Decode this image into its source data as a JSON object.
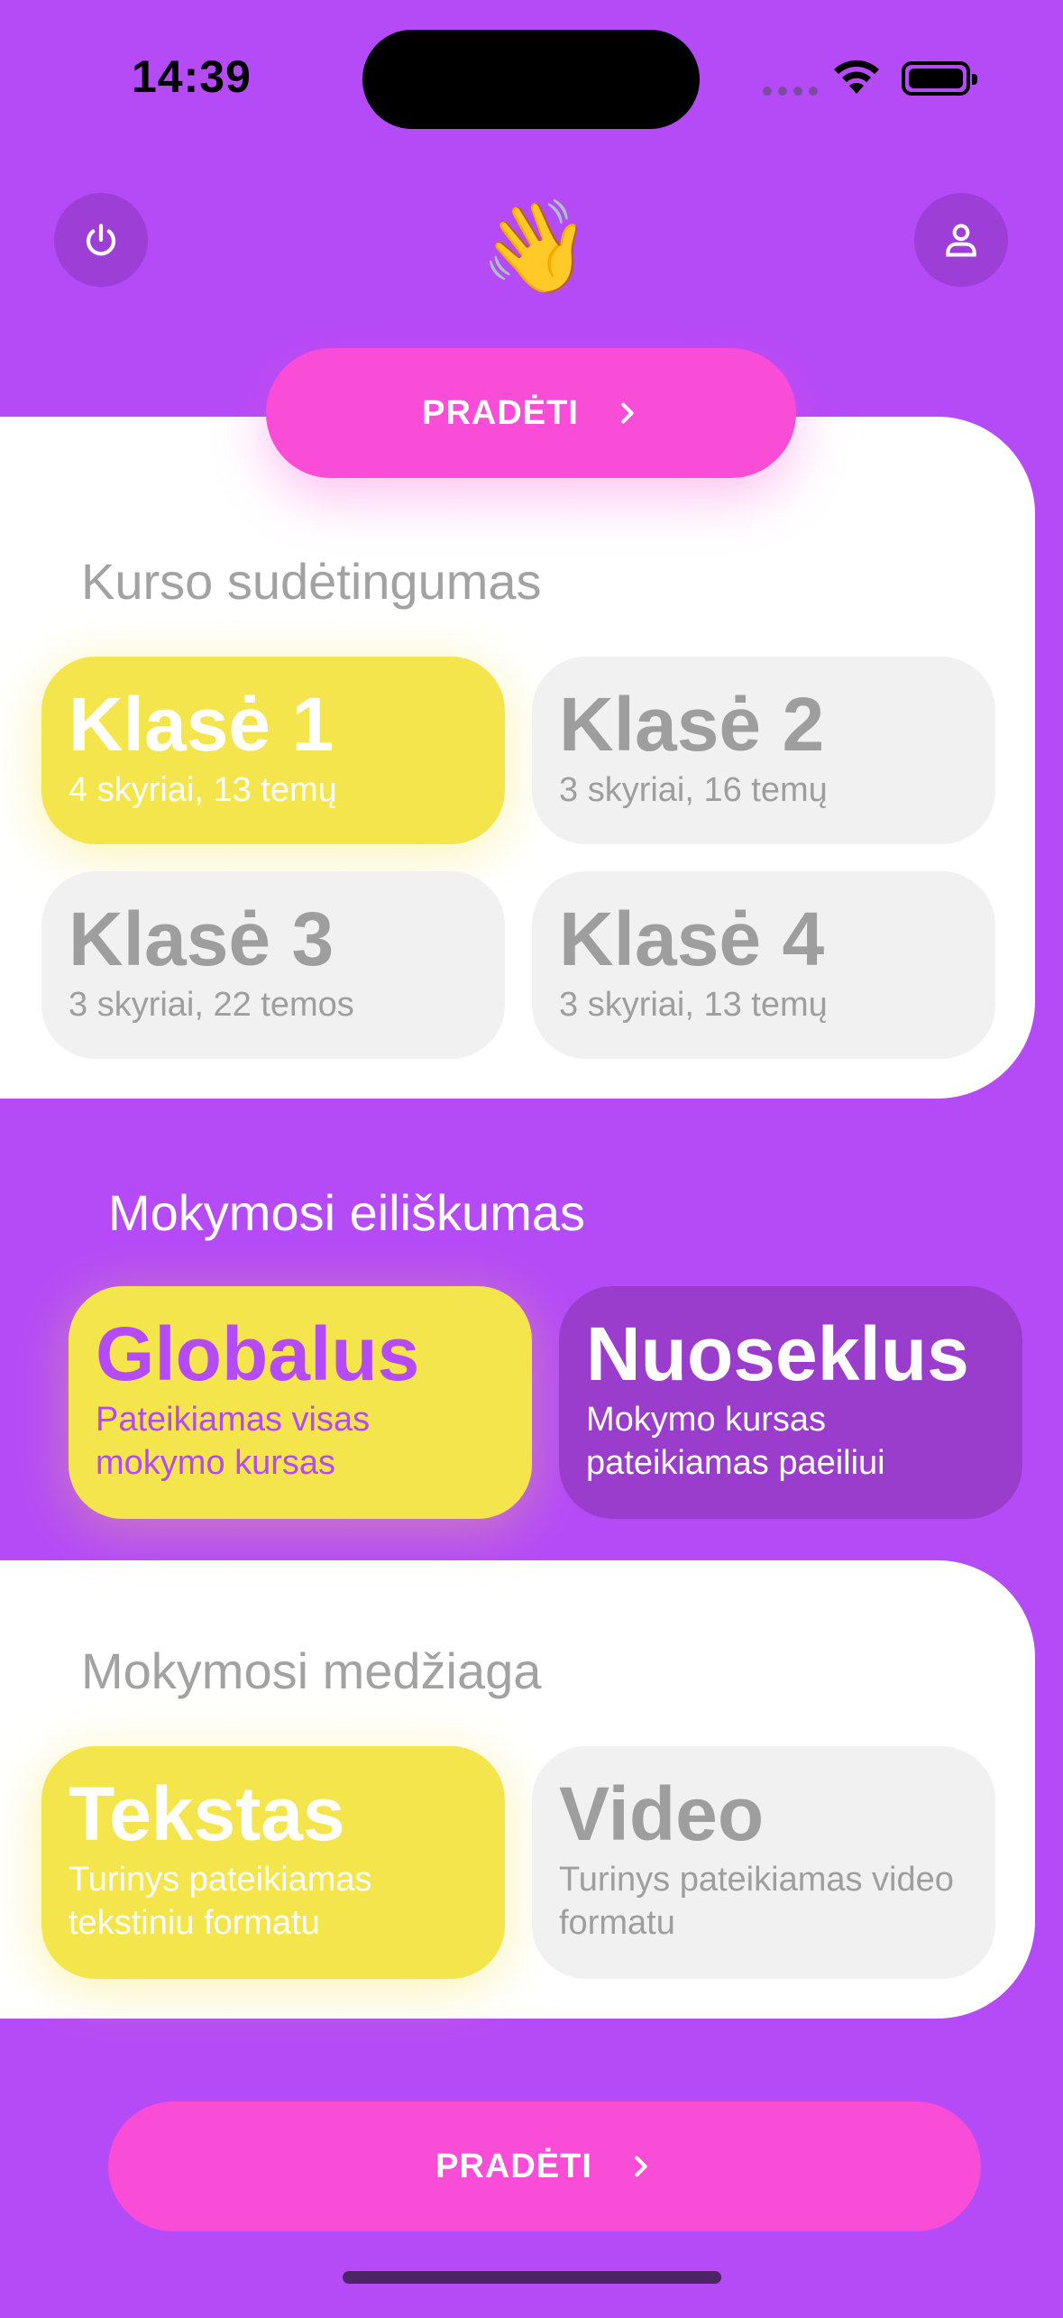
{
  "status_bar": {
    "time": "14:39"
  },
  "header": {
    "emoji": "👋",
    "power_icon": "power-icon",
    "profile_icon": "user-icon"
  },
  "start_button_top": {
    "label": "PRADĖTI"
  },
  "difficulty": {
    "title": "Kurso sudėtingumas",
    "options": [
      {
        "title": "Klasė 1",
        "subtitle": "4 skyriai, 13 temų",
        "selected": true
      },
      {
        "title": "Klasė 2",
        "subtitle": "3 skyriai, 16 temų",
        "selected": false
      },
      {
        "title": "Klasė 3",
        "subtitle": "3 skyriai, 22 temos",
        "selected": false
      },
      {
        "title": "Klasė 4",
        "subtitle": "3 skyriai, 13 temų",
        "selected": false
      }
    ]
  },
  "order": {
    "title": "Mokymosi eiliškumas",
    "options": [
      {
        "title": "Globalus",
        "subtitle": "Pateikiamas visas mokymo kursas",
        "selected": true
      },
      {
        "title": "Nuoseklus",
        "subtitle": "Mokymo kursas pateikiamas paeiliui",
        "selected": false
      }
    ]
  },
  "material": {
    "title": "Mokymosi medžiaga",
    "options": [
      {
        "title": "Tekstas",
        "subtitle": "Turinys pateikiamas tekstiniu formatu",
        "selected": true
      },
      {
        "title": "Video",
        "subtitle": "Turinys pateikiamas video formatu",
        "selected": false
      }
    ]
  },
  "start_button_bottom": {
    "label": "PRADĖTI"
  },
  "colors": {
    "background": "#b54bf7",
    "accent_pink": "#f94dd7",
    "selected_yellow": "#f5e54d",
    "unselected_grey": "#f1f1f1",
    "dark_purple": "#9a3dcc"
  }
}
